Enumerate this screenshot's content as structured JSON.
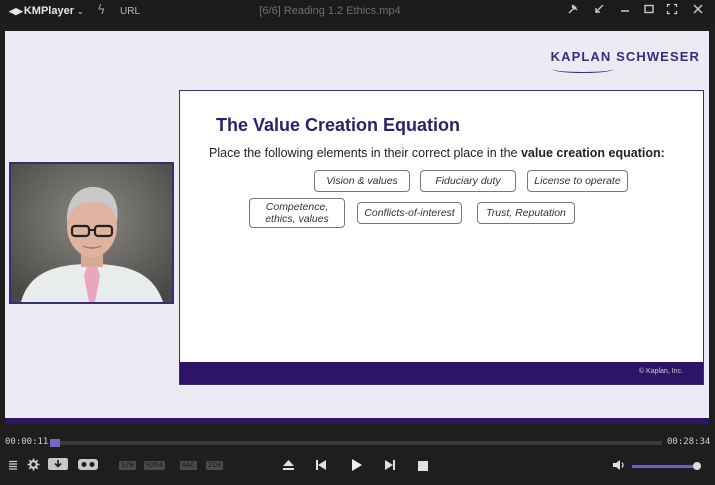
{
  "titlebar": {
    "app_name": "KMPlayer",
    "url_label": "URL",
    "file_title": "[6/6] Reading 1.2 Ethics.mp4",
    "icons": [
      "pin-icon",
      "mini-mode-icon",
      "minimize-icon",
      "maximize-icon",
      "fullscreen-icon",
      "close-icon"
    ]
  },
  "video": {
    "brand": "KAPLAN SCHWESER",
    "slide": {
      "title": "The Value Creation Equation",
      "intro_prefix": "Place the following elements in their correct place in the ",
      "intro_bold": "value creation equation:",
      "chips": [
        "Vision & values",
        "Fiduciary duty",
        "License to operate",
        "Competence, ethics, values",
        "Conflicts-of-interest",
        "Trust, Reputation"
      ],
      "copyright": "© Kaplan, Inc."
    }
  },
  "playback": {
    "current_time": "00:00:11",
    "total_time": "00:28:34",
    "progress": 0.0064,
    "volume": 1.0
  },
  "controls": {
    "badges": [
      "S/W",
      "H264",
      "AAC",
      "2CH"
    ],
    "icons": [
      "menu-icon",
      "settings-icon",
      "download-icon",
      "vr-icon",
      "eject-icon",
      "previous-icon",
      "play-icon",
      "next-icon",
      "stop-icon",
      "volume-icon"
    ]
  },
  "colors": {
    "accent": "#7a55e0",
    "brand_purple": "#3d2b82",
    "slide_footer": "#2e1466"
  }
}
